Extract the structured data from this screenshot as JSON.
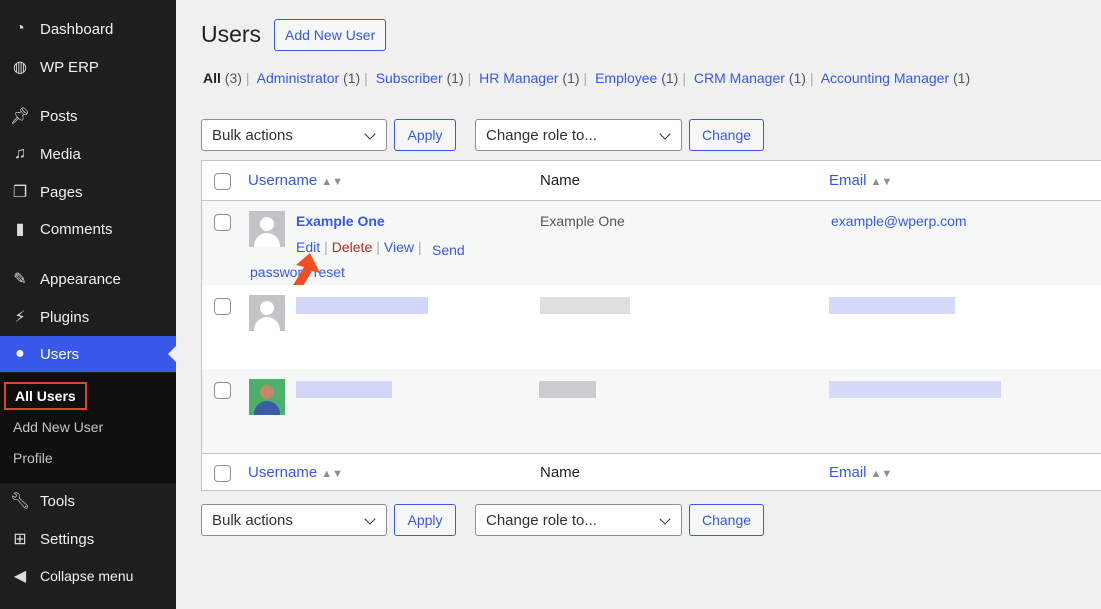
{
  "sidebar": {
    "items": [
      {
        "label": "Dashboard",
        "icon": "dashboard-icon"
      },
      {
        "label": "WP ERP",
        "icon": "wp-erp-icon"
      },
      {
        "label": "Posts",
        "icon": "pin-icon"
      },
      {
        "label": "Media",
        "icon": "media-icon"
      },
      {
        "label": "Pages",
        "icon": "pages-icon"
      },
      {
        "label": "Comments",
        "icon": "comment-icon"
      },
      {
        "label": "Appearance",
        "icon": "brush-icon"
      },
      {
        "label": "Plugins",
        "icon": "plugin-icon"
      },
      {
        "label": "Users",
        "icon": "user-icon",
        "active": true
      },
      {
        "label": "Tools",
        "icon": "wrench-icon"
      },
      {
        "label": "Settings",
        "icon": "settings-icon"
      },
      {
        "label": "Collapse menu",
        "icon": "collapse-icon"
      }
    ],
    "submenu": [
      "All Users",
      "Add New User",
      "Profile"
    ]
  },
  "header": {
    "title": "Users",
    "add_new": "Add New User"
  },
  "filters": [
    {
      "label": "All",
      "count": "(3)"
    },
    {
      "label": "Administrator",
      "count": "(1)"
    },
    {
      "label": "Subscriber",
      "count": "(1)"
    },
    {
      "label": "HR Manager",
      "count": "(1)"
    },
    {
      "label": "Employee",
      "count": "(1)"
    },
    {
      "label": "CRM Manager",
      "count": "(1)"
    },
    {
      "label": "Accounting Manager",
      "count": "(1)"
    }
  ],
  "actions": {
    "bulk": "Bulk actions",
    "apply": "Apply",
    "role": "Change role to...",
    "change": "Change"
  },
  "table": {
    "columns": {
      "username": "Username",
      "name": "Name",
      "email": "Email"
    },
    "rows": [
      {
        "username": "Example One",
        "name": "Example One",
        "email": "example@wperp.com",
        "row_actions": {
          "edit": "Edit",
          "delete": "Delete",
          "view": "View",
          "send": "Send password reset"
        }
      }
    ]
  },
  "colors": {
    "accent": "#3858e9",
    "sidebar": "#1e1e1e",
    "delete": "#b32d2e",
    "annotation": "#f04e23"
  }
}
